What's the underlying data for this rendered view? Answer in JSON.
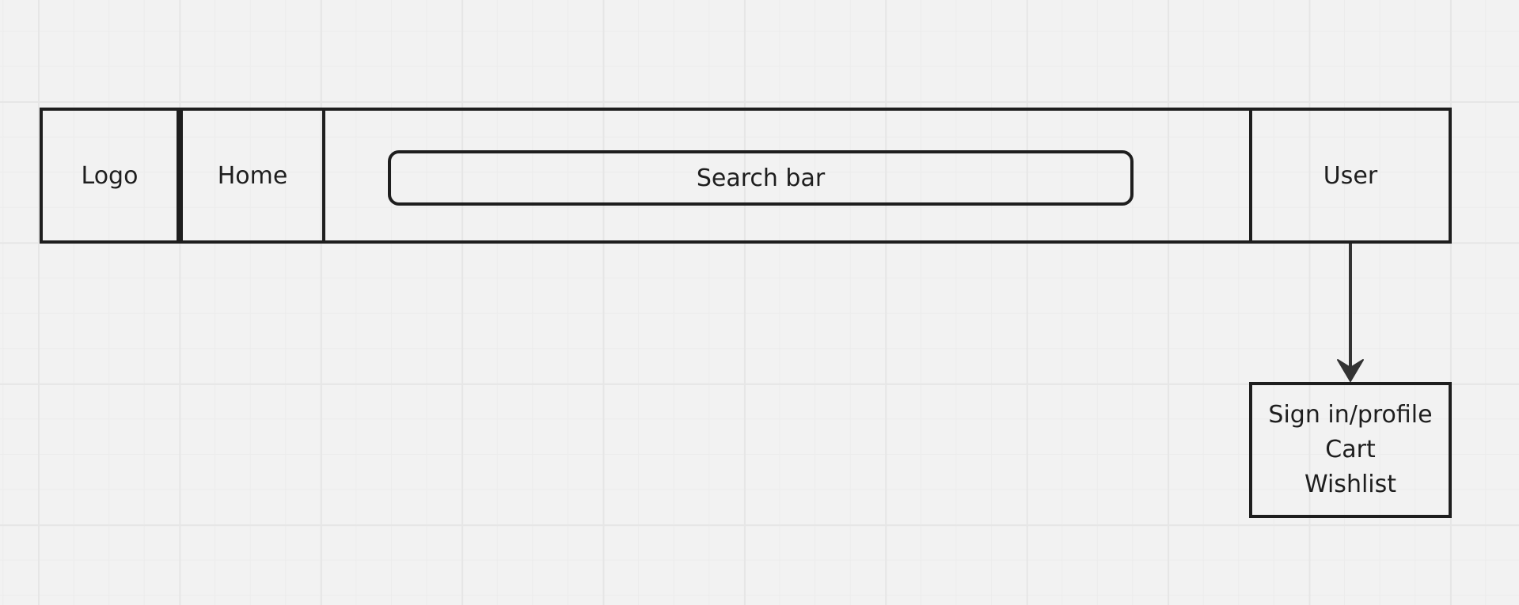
{
  "diagram": {
    "nodes": {
      "logo": "Logo",
      "home": "Home",
      "search": "Search bar",
      "user": "User"
    },
    "user_menu": {
      "items": [
        "Sign in/profile",
        "Cart",
        "Wishlist"
      ]
    },
    "colors": {
      "stroke": "#1e1e1e",
      "background": "#f2f2f2",
      "grid": "#e6e6e6"
    }
  }
}
